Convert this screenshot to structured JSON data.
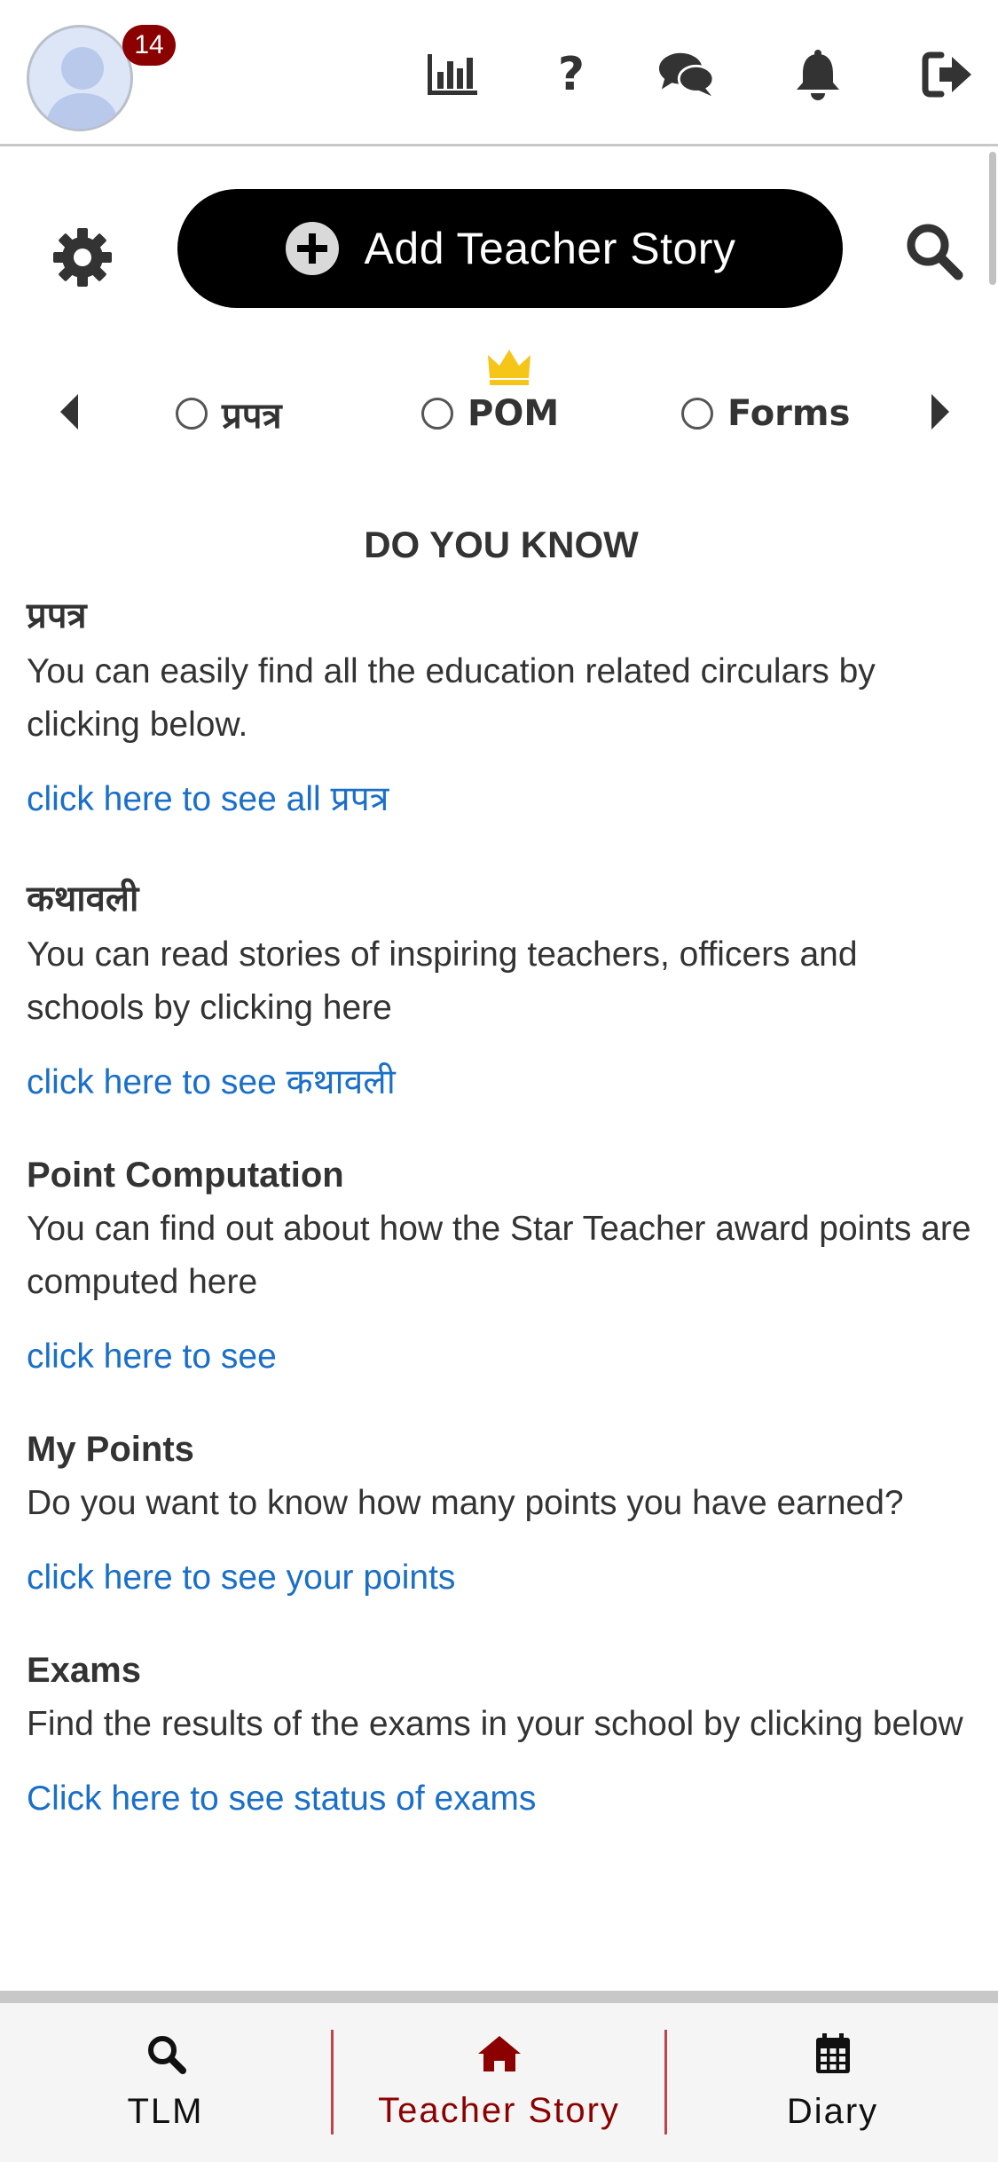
{
  "header": {
    "notification_count": "14",
    "icons": [
      "chart-icon",
      "help-icon",
      "chat-icon",
      "bell-icon",
      "logout-icon"
    ],
    "help_glyph": "?"
  },
  "action_bar": {
    "add_button_label": "Add Teacher Story"
  },
  "filters": {
    "items": [
      {
        "label": "प्रपत्र",
        "selected": false
      },
      {
        "label": "POM",
        "selected": false,
        "badge": "crown-icon"
      },
      {
        "label": "Forms",
        "selected": false
      }
    ]
  },
  "content": {
    "title": "DO YOU KNOW",
    "sections": [
      {
        "title": "प्रपत्र",
        "description": "You can easily find all the education related circulars by clicking below.",
        "link": "click here to see all प्रपत्र"
      },
      {
        "title": "कथावली",
        "description": "You can read stories of inspiring teachers, officers and schools by clicking here",
        "link": "click here to see कथावली"
      },
      {
        "title": "Point Computation",
        "description": "You can find out about how the Star Teacher award points are computed here",
        "link": "click here to see"
      },
      {
        "title": "My Points",
        "description": "Do you want to know how many points you have earned?",
        "link": "click here to see your points"
      },
      {
        "title": "Exams",
        "description": "Find the results of the exams in your school by clicking below",
        "link": "Click here to see status of exams"
      }
    ]
  },
  "bottom_nav": {
    "items": [
      {
        "label": "TLM",
        "icon": "search-icon"
      },
      {
        "label": "Teacher Story",
        "icon": "home-icon",
        "active": true
      },
      {
        "label": "Diary",
        "icon": "calendar-icon"
      }
    ]
  },
  "colors": {
    "accent_dark_red": "#8b0000",
    "link_blue": "#1a6fc9",
    "button_black": "#000000",
    "crown_gold": "#f5c518"
  }
}
